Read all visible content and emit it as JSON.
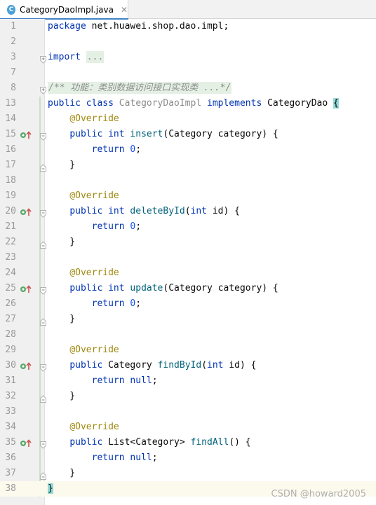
{
  "tab": {
    "title": "CategoryDaoImpl.java",
    "icon": "java-class-icon",
    "close": "✕"
  },
  "lines": [
    {
      "n": "1",
      "code": "package net.huawei.shop.dao.impl;"
    },
    {
      "n": "2",
      "code": ""
    },
    {
      "n": "3",
      "code": "import ..."
    },
    {
      "n": "7",
      "code": ""
    },
    {
      "n": "8",
      "code": "/** 功能：类别数据访问接口实现类 ...*/"
    },
    {
      "n": "13",
      "code": "public class CategoryDaoImpl implements CategoryDao {"
    },
    {
      "n": "14",
      "code": "    @Override"
    },
    {
      "n": "15",
      "code": "    public int insert(Category category) {",
      "marker": "implements-method"
    },
    {
      "n": "16",
      "code": "        return 0;"
    },
    {
      "n": "17",
      "code": "    }"
    },
    {
      "n": "18",
      "code": ""
    },
    {
      "n": "19",
      "code": "    @Override"
    },
    {
      "n": "20",
      "code": "    public int deleteById(int id) {",
      "marker": "implements-method"
    },
    {
      "n": "21",
      "code": "        return 0;"
    },
    {
      "n": "22",
      "code": "    }"
    },
    {
      "n": "23",
      "code": ""
    },
    {
      "n": "24",
      "code": "    @Override"
    },
    {
      "n": "25",
      "code": "    public int update(Category category) {",
      "marker": "implements-method"
    },
    {
      "n": "26",
      "code": "        return 0;"
    },
    {
      "n": "27",
      "code": "    }"
    },
    {
      "n": "28",
      "code": ""
    },
    {
      "n": "29",
      "code": "    @Override"
    },
    {
      "n": "30",
      "code": "    public Category findById(int id) {",
      "marker": "implements-method"
    },
    {
      "n": "31",
      "code": "        return null;"
    },
    {
      "n": "32",
      "code": "    }"
    },
    {
      "n": "33",
      "code": ""
    },
    {
      "n": "34",
      "code": "    @Override"
    },
    {
      "n": "35",
      "code": "    public List<Category> findAll() {",
      "marker": "implements-method"
    },
    {
      "n": "36",
      "code": "        return null;"
    },
    {
      "n": "37",
      "code": "    }"
    },
    {
      "n": "38",
      "code": "}"
    }
  ],
  "watermark": "CSDN @howard2005",
  "colors": {
    "keyword": "#0033b3",
    "annotation": "#9e880d",
    "comment": "#8c8c8c",
    "number": "#1750eb",
    "function": "#00627a",
    "current_line": "#fcfaed",
    "brace_match": "#93d9d9"
  }
}
